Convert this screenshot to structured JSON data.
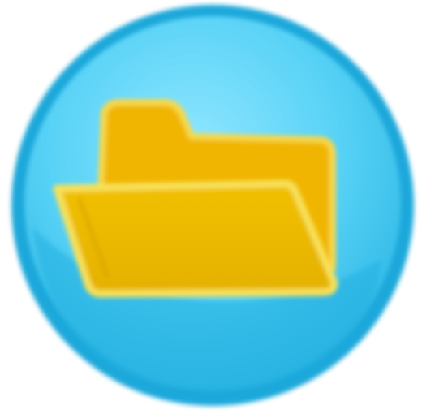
{
  "icon": {
    "name": "open-folder-icon",
    "colors": {
      "circle_outer": "#1aa6d8",
      "circle_inner": "#58d2f6",
      "circle_highlight": "#8ee6ff",
      "circle_shadow": "#149ccf",
      "folder_back": "#f2b400",
      "folder_front": "#e8b800",
      "folder_outline": "#f9e45c",
      "folder_shade": "#d6a200"
    }
  }
}
